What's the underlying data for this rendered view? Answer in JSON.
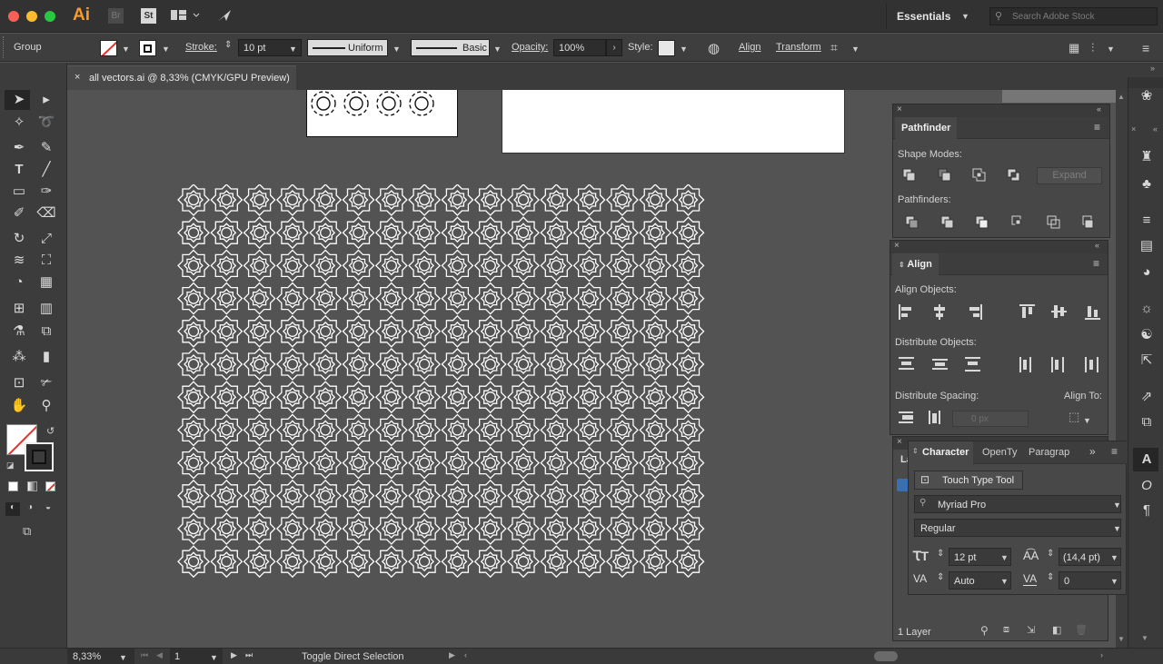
{
  "app": {
    "logo": "Ai",
    "bridge": "Br",
    "stock": "St",
    "workspace": "Essentials",
    "search_placeholder": "Search Adobe Stock"
  },
  "control_bar": {
    "selection_type": "Group",
    "stroke_label": "Stroke:",
    "stroke_weight": "10 pt",
    "profile": "Uniform",
    "brush": "Basic",
    "opacity_label": "Opacity:",
    "opacity_value": "100%",
    "style_label": "Style:",
    "align_label": "Align",
    "transform_label": "Transform"
  },
  "document": {
    "tab_title": "all vectors.ai @ 8,33% (CMYK/GPU Preview)",
    "close": "×"
  },
  "pathfinder": {
    "title": "Pathfinder",
    "shape_modes_label": "Shape Modes:",
    "expand_label": "Expand",
    "pathfinders_label": "Pathfinders:"
  },
  "align_panel": {
    "title": "Align",
    "align_objects_label": "Align Objects:",
    "distribute_objects_label": "Distribute Objects:",
    "distribute_spacing_label": "Distribute Spacing:",
    "align_to_label": "Align To:",
    "spacing_value": "0 px"
  },
  "character": {
    "tab_character": "Character",
    "tab_opentype": "OpenTy",
    "tab_paragraph": "Paragrap",
    "touch_type": "Touch Type Tool",
    "font_family": "Myriad Pro",
    "font_style": "Regular",
    "font_size": "12 pt",
    "leading": "(14,4 pt)",
    "kerning": "Auto",
    "tracking": "0"
  },
  "layers": {
    "count": "1 Layer",
    "tab_partial": "La"
  },
  "status": {
    "zoom": "8,33%",
    "artboard": "1",
    "tool_hint": "Toggle Direct Selection"
  },
  "colors": {
    "accent_red": "#e3332a",
    "traffic_close": "#fc5f57",
    "traffic_min": "#fdbc2e",
    "traffic_max": "#28c840",
    "logo": "#f79a30"
  }
}
